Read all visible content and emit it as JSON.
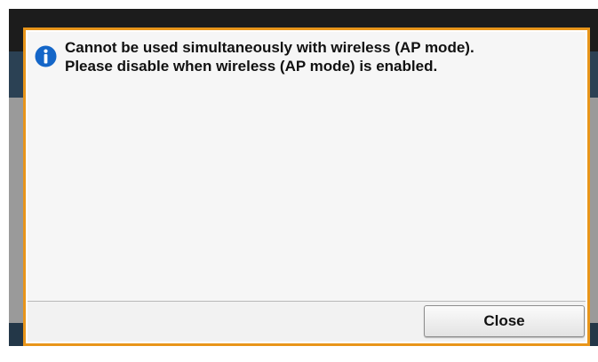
{
  "dialog": {
    "icon": "info-icon",
    "message_lines": [
      "Cannot be used simultaneously with wireless (AP mode).",
      "Please disable when wireless (AP mode) is enabled."
    ],
    "close_label": "Close"
  },
  "colors": {
    "border_accent": "#e8951a",
    "info_icon": "#1466c8",
    "background_dark": "#1c1c1c",
    "band_blue": "#2b4154"
  }
}
